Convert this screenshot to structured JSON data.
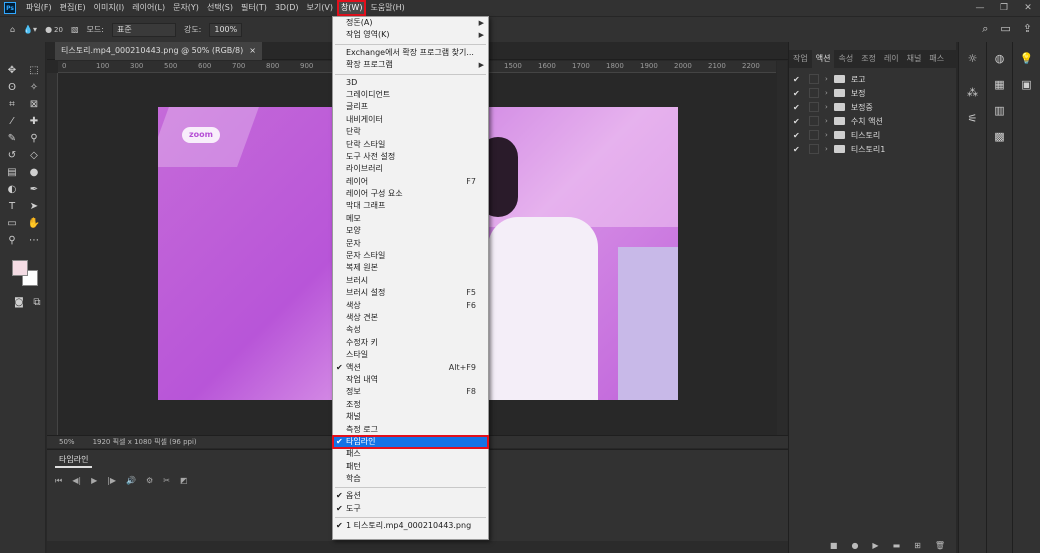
{
  "menubar": {
    "logo": "Ps",
    "items": [
      "파일(F)",
      "편집(E)",
      "이미지(I)",
      "레이어(L)",
      "문자(Y)",
      "선택(S)",
      "필터(T)",
      "3D(D)",
      "보기(V)",
      "창(W)",
      "도움말(H)"
    ],
    "active_index": 9,
    "window_controls": [
      "—",
      "❐",
      "✕"
    ]
  },
  "optbar": {
    "brush_size": "20",
    "mode_label": "모드:",
    "mode_value": "표준",
    "opacity_label": "강도:",
    "opacity_value": "100%"
  },
  "document": {
    "tab_title": "티스토리.mp4_000210443.png @ 50% (RGB/8)",
    "close": "×",
    "zoom": "50%",
    "size_info": "1920 픽셀 x 1080 픽셀 (96 ppi)",
    "watermark": "zoom"
  },
  "ruler": {
    "ticks": [
      "0",
      "100",
      "300",
      "500",
      "600",
      "700",
      "800",
      "900",
      "1000",
      "1100",
      "1200",
      "1300",
      "1400",
      "1500",
      "1600",
      "1700",
      "1800",
      "1900",
      "2000",
      "2100",
      "2200"
    ]
  },
  "timeline": {
    "tab_label": "타임라인",
    "controls": [
      "⏮",
      "◀|",
      "▶",
      "|▶",
      "🔊",
      "⚙",
      "✂",
      "◩"
    ]
  },
  "panel": {
    "tabs": [
      "작업",
      "액션",
      "속성",
      "조정",
      "레이",
      "채널",
      "패스"
    ],
    "active_tab": 1,
    "actions": [
      {
        "check": "✔",
        "label": "로고"
      },
      {
        "check": "✔",
        "label": "보정"
      },
      {
        "check": "✔",
        "label": "보정중"
      },
      {
        "check": "✔",
        "label": "수치 액션"
      },
      {
        "check": "✔",
        "label": "티스토리"
      },
      {
        "check": "✔",
        "label": "티스토리1"
      }
    ]
  },
  "window_menu": {
    "items": [
      {
        "label": "정돈(A)",
        "submenu": true
      },
      {
        "label": "작업 영역(K)",
        "submenu": true
      },
      {
        "sep": true
      },
      {
        "label": "Exchange에서 확장 프로그램 찾기..."
      },
      {
        "label": "확장 프로그램",
        "submenu": true
      },
      {
        "sep": true
      },
      {
        "label": "3D"
      },
      {
        "label": "그레이디언트"
      },
      {
        "label": "글리프"
      },
      {
        "label": "내비게이터"
      },
      {
        "label": "단락"
      },
      {
        "label": "단락 스타일"
      },
      {
        "label": "도구 사전 설정"
      },
      {
        "label": "라이브러리"
      },
      {
        "label": "레이어",
        "shortcut": "F7"
      },
      {
        "label": "레이어 구성 요소"
      },
      {
        "label": "막대 그래프"
      },
      {
        "label": "메모"
      },
      {
        "label": "모양"
      },
      {
        "label": "문자"
      },
      {
        "label": "문자 스타일"
      },
      {
        "label": "복제 원본"
      },
      {
        "label": "브러시"
      },
      {
        "label": "브러시 설정",
        "shortcut": "F5"
      },
      {
        "label": "색상",
        "shortcut": "F6"
      },
      {
        "label": "색상 견본"
      },
      {
        "label": "속성"
      },
      {
        "label": "수정자 키"
      },
      {
        "label": "스타일"
      },
      {
        "label": "액션",
        "check": "✔",
        "shortcut": "Alt+F9"
      },
      {
        "label": "작업 내역"
      },
      {
        "label": "정보",
        "shortcut": "F8"
      },
      {
        "label": "조정"
      },
      {
        "label": "채널"
      },
      {
        "label": "측정 로그"
      },
      {
        "label": "타임라인",
        "check": "✔",
        "highlight": true
      },
      {
        "label": "패스"
      },
      {
        "label": "패턴"
      },
      {
        "label": "학습"
      },
      {
        "sep": true
      },
      {
        "label": "옵션",
        "check": "✔"
      },
      {
        "label": "도구",
        "check": "✔"
      },
      {
        "sep": true
      },
      {
        "label": "1 티스토리.mp4_000210443.png",
        "check": "✔"
      }
    ]
  }
}
